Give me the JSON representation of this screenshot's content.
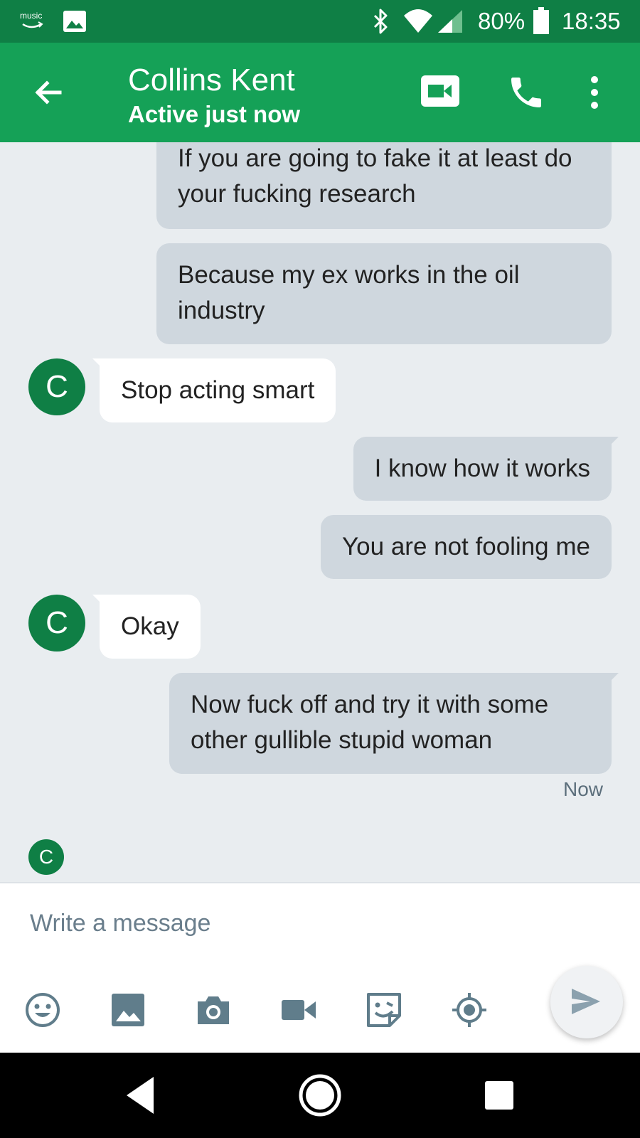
{
  "status_bar": {
    "music_label": "music",
    "battery_percent": "80%",
    "time": "18:35"
  },
  "header": {
    "contact_name": "Collins Kent",
    "presence": "Active just now"
  },
  "avatar_initial": "C",
  "messages": [
    {
      "direction": "outgoing",
      "text": "If you are going to fake it at least do your fucking research"
    },
    {
      "direction": "outgoing",
      "text": "Because my ex works in the oil industry"
    },
    {
      "direction": "incoming",
      "text": "Stop acting smart"
    },
    {
      "direction": "outgoing",
      "text": "I know how it works"
    },
    {
      "direction": "outgoing",
      "text": "You are not fooling me"
    },
    {
      "direction": "incoming",
      "text": "Okay"
    },
    {
      "direction": "outgoing",
      "text": "Now fuck off and try it with some other gullible stupid woman"
    }
  ],
  "last_timestamp": "Now",
  "composer": {
    "placeholder": "Write a message"
  },
  "colors": {
    "status_bar": "#0f7f45",
    "app_bar": "#15a157",
    "outgoing_bubble": "#cfd7de",
    "incoming_bubble": "#ffffff",
    "background": "#e9edf0",
    "icon_gray": "#607d8b"
  },
  "icons": {
    "toolbar": [
      "emoji-icon",
      "gallery-icon",
      "camera-icon",
      "video-icon",
      "sticker-icon",
      "location-icon"
    ],
    "header": [
      "back-arrow-icon",
      "video-call-icon",
      "phone-icon",
      "more-vert-icon"
    ],
    "nav": [
      "nav-back-icon",
      "nav-home-icon",
      "nav-recents-icon"
    ]
  }
}
